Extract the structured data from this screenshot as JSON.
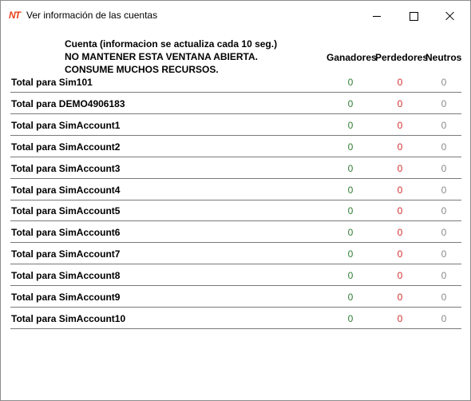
{
  "window": {
    "title": "Ver información de las cuentas",
    "app_icon_text": "NT",
    "controls": {
      "minimize": "minimize",
      "maximize": "maximize",
      "close": "close"
    }
  },
  "notice": {
    "line1": "Cuenta (informacion se actualiza cada 10 seg.)",
    "line2": "NO MANTENER ESTA VENTANA ABIERTA.",
    "line3": "CONSUME MUCHOS RECURSOS."
  },
  "columns": {
    "ganadores": "Ganadores",
    "perdedores": "Perdedores",
    "neutros": "Neutros"
  },
  "rows": [
    {
      "label": "Total para Sim101",
      "ganadores": "0",
      "perdedores": "0",
      "neutros": "0"
    },
    {
      "label": "Total para DEMO4906183",
      "ganadores": "0",
      "perdedores": "0",
      "neutros": "0"
    },
    {
      "label": "Total para SimAccount1",
      "ganadores": "0",
      "perdedores": "0",
      "neutros": "0"
    },
    {
      "label": "Total para SimAccount2",
      "ganadores": "0",
      "perdedores": "0",
      "neutros": "0"
    },
    {
      "label": "Total para SimAccount3",
      "ganadores": "0",
      "perdedores": "0",
      "neutros": "0"
    },
    {
      "label": "Total para SimAccount4",
      "ganadores": "0",
      "perdedores": "0",
      "neutros": "0"
    },
    {
      "label": "Total para SimAccount5",
      "ganadores": "0",
      "perdedores": "0",
      "neutros": "0"
    },
    {
      "label": "Total para SimAccount6",
      "ganadores": "0",
      "perdedores": "0",
      "neutros": "0"
    },
    {
      "label": "Total para SimAccount7",
      "ganadores": "0",
      "perdedores": "0",
      "neutros": "0"
    },
    {
      "label": "Total para SimAccount8",
      "ganadores": "0",
      "perdedores": "0",
      "neutros": "0"
    },
    {
      "label": "Total para SimAccount9",
      "ganadores": "0",
      "perdedores": "0",
      "neutros": "0"
    },
    {
      "label": "Total para SimAccount10",
      "ganadores": "0",
      "perdedores": "0",
      "neutros": "0"
    }
  ],
  "colors": {
    "ganadores": "#2e7d32",
    "perdedores": "#d32f2f",
    "neutros": "#8a8a8a",
    "accent": "#e8421c"
  }
}
